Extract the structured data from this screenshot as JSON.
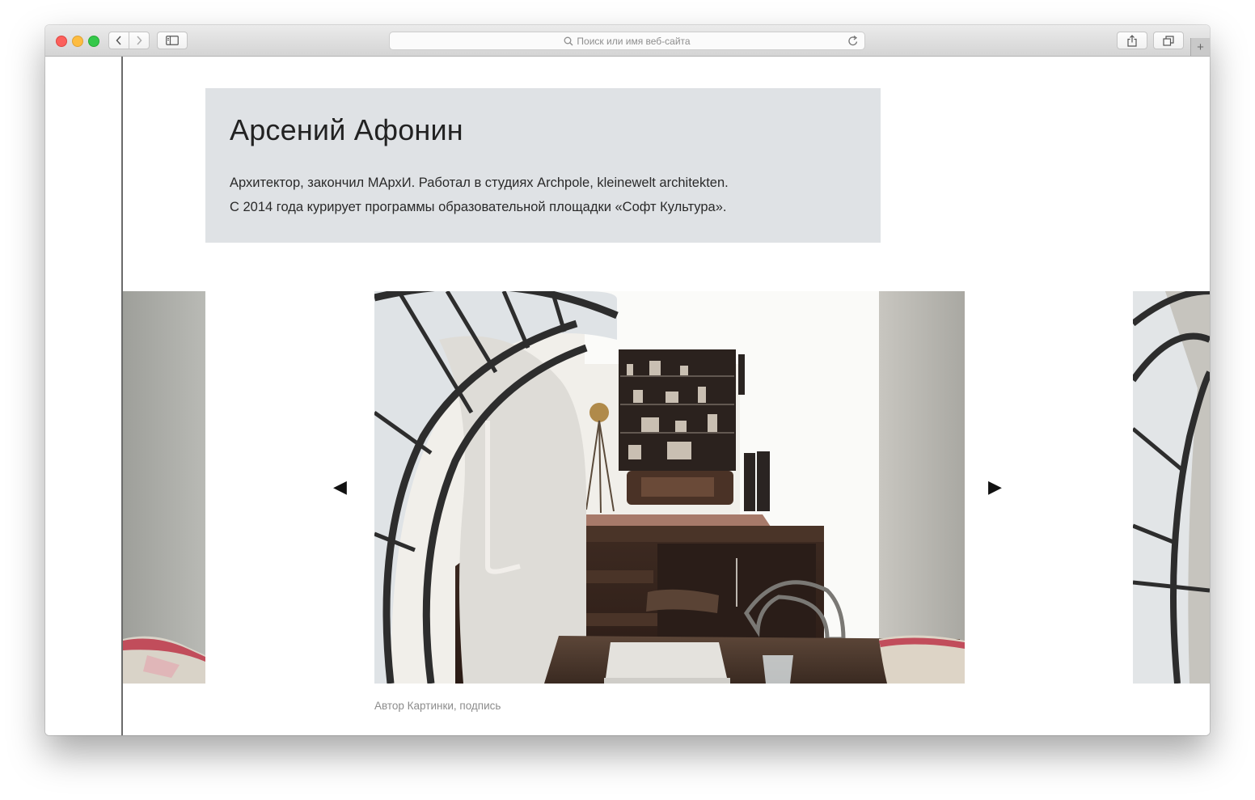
{
  "browser": {
    "url_placeholder": "Поиск или имя веб-сайта",
    "new_tab_symbol": "+"
  },
  "bio": {
    "name": "Арсений Афонин",
    "line1": "Архитектор, закончил МАрхИ. Работал в студиях Archpole, kleinewelt architekten.",
    "line2": "С 2014 года курирует программы образовательной площадки «Софт Культура»."
  },
  "gallery": {
    "prev_arrow": "◀",
    "next_arrow": "▶",
    "caption": "Автор Картинки, подпись"
  }
}
